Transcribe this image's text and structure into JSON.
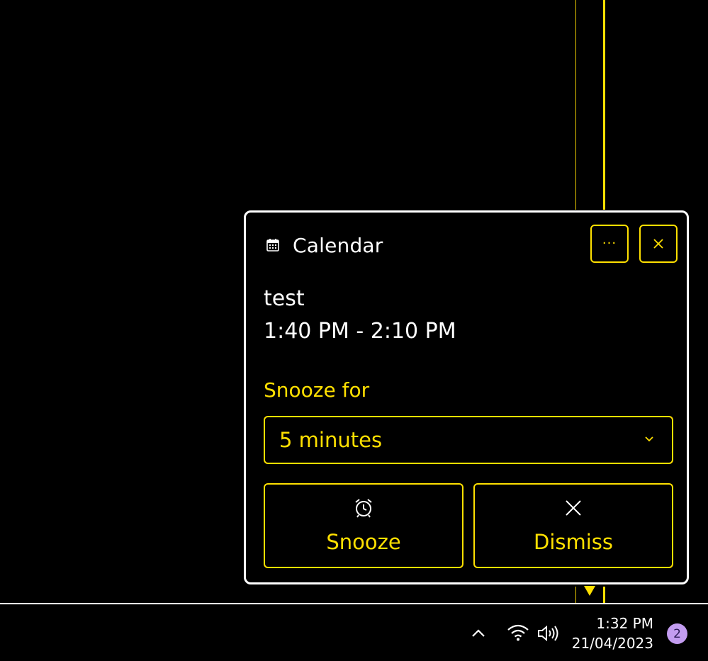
{
  "notification": {
    "app_name": "Calendar",
    "app_icon": "calendar-icon",
    "more_button_label": "···",
    "event_title": "test",
    "event_time": "1:40 PM - 2:10 PM",
    "snooze_label": "Snooze for",
    "snooze_select": {
      "selected": "5 minutes"
    },
    "snooze_button": {
      "label": "Snooze",
      "icon": "alarm-clock-icon"
    },
    "dismiss_button": {
      "label": "Dismiss",
      "icon": "close-icon"
    }
  },
  "taskbar": {
    "time": "1:32 PM",
    "date": "21/04/2023",
    "notification_count": "2",
    "tray_icons": [
      "chevron-up-icon",
      "wifi-icon",
      "volume-icon"
    ]
  },
  "colors": {
    "accent": "#ffe000",
    "border": "#ffffff",
    "background": "#000000",
    "badge": "#c39cf0"
  }
}
